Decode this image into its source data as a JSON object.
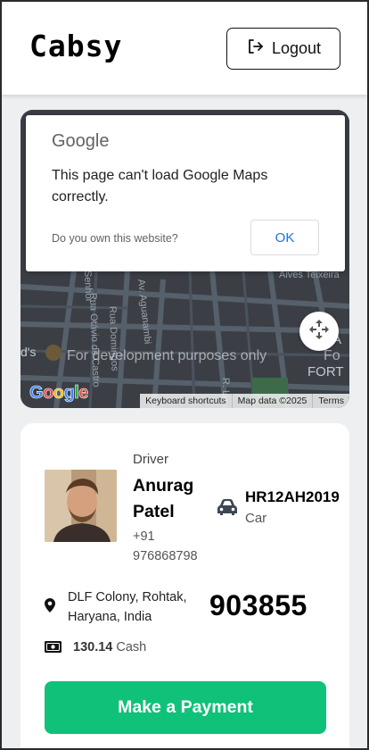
{
  "header": {
    "brand": "Cabsy",
    "logout_label": "Logout"
  },
  "map": {
    "dialog": {
      "logo_text": "Google",
      "message": "This page can't load Google Maps correctly.",
      "question": "Do you own this website?",
      "ok_label": "OK"
    },
    "dev_watermark": "For development purposes only",
    "dev_watermark_right": "Fo",
    "wordmark": "Google",
    "footer": {
      "shortcuts": "Keyboard shortcuts",
      "attribution": "Map data ©2025",
      "terms": "Terms"
    },
    "street_labels": [
      "Rua Domingos",
      "Rua Otávio de Castro",
      "Av. Aguanambi",
      "Senhor",
      "R. Lu",
      "Aives Teixeira",
      "FORT",
      "A",
      "d's"
    ]
  },
  "ride": {
    "driver_role": "Driver",
    "driver_name": "Anurag Patel",
    "driver_phone": "+91 976868798",
    "plate": "HR12AH2019",
    "vehicle_type": "Car",
    "location": "DLF Colony, Rohtak, Haryana, India",
    "otp": "903855",
    "fare_amount": "130.14",
    "fare_method": "Cash",
    "pay_label": "Make a Payment"
  },
  "colors": {
    "accent": "#10c179",
    "map_bg": "#3a3d42",
    "dialog_link": "#1a73e8"
  },
  "icons": {
    "logout": "logout-icon",
    "fullscreen": "fullscreen-icon",
    "car": "car-icon",
    "pin": "map-pin-icon",
    "cash": "cash-icon"
  }
}
